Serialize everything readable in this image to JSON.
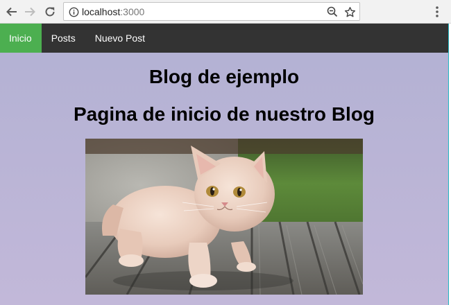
{
  "browser": {
    "url_host": "localhost",
    "url_port": ":3000",
    "icons": {
      "back": "back-arrow-icon",
      "forward": "forward-arrow-icon",
      "reload": "reload-icon",
      "info": "info-icon",
      "zoom": "zoom-out-icon",
      "bookmark": "bookmark-star-icon",
      "menu": "kebab-menu-icon"
    }
  },
  "nav": {
    "items": [
      {
        "label": "Inicio",
        "active": true
      },
      {
        "label": "Posts",
        "active": false
      },
      {
        "label": "Nuevo Post",
        "active": false
      }
    ],
    "bar_color": "#333333",
    "active_color": "#4caf50"
  },
  "page": {
    "title": "Blog de ejemplo",
    "subtitle": "Pagina de inicio de nuestro Blog",
    "background": "#b4b2d5"
  },
  "image": {
    "subject": "kitten-photo"
  }
}
